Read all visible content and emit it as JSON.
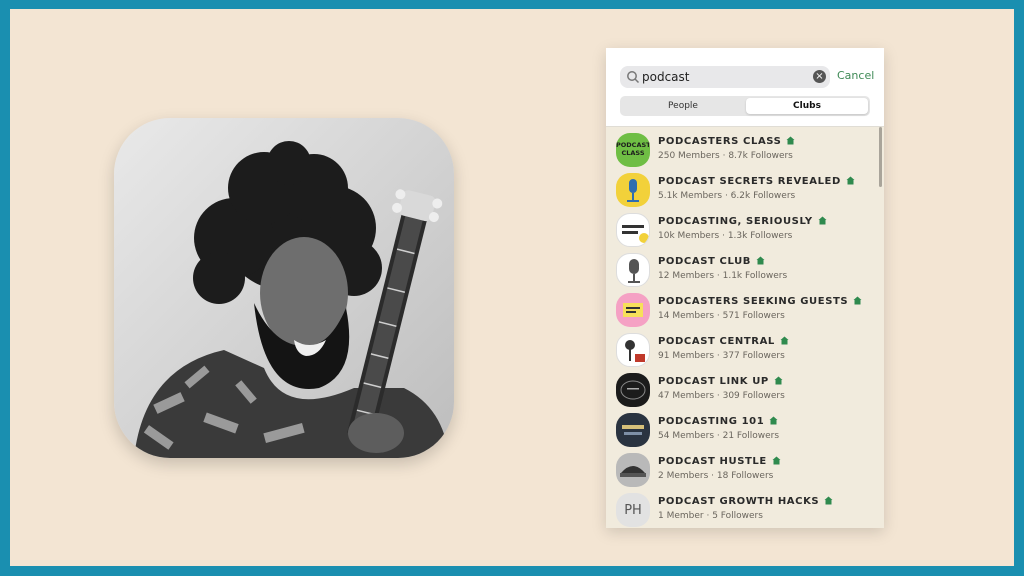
{
  "search": {
    "value": "podcast",
    "cancel_label": "Cancel"
  },
  "tabs": [
    {
      "label": "People",
      "selected": false
    },
    {
      "label": "Clubs",
      "selected": true
    }
  ],
  "clubs": [
    {
      "name": "PODCASTERS CLASS",
      "meta": "250 Members · 8.7k Followers",
      "avatar_text": "PODCAST CLASS",
      "avatar_color": "#6fbe44"
    },
    {
      "name": "PODCAST SECRETS REVEALED",
      "meta": "5.1k Members · 6.2k Followers",
      "avatar_text": "",
      "avatar_color": "#f2d13a"
    },
    {
      "name": "PODCASTING, SERIOUSLY",
      "meta": "10k Members · 1.3k Followers",
      "avatar_text": "",
      "avatar_color": "#ffffff"
    },
    {
      "name": "PODCAST CLUB",
      "meta": "12 Members · 1.1k Followers",
      "avatar_text": "",
      "avatar_color": "#ffffff"
    },
    {
      "name": "PODCASTERS SEEKING GUESTS",
      "meta": "14 Members · 571 Followers",
      "avatar_text": "",
      "avatar_color": "#f5a1c4"
    },
    {
      "name": "PODCAST CENTRAL",
      "meta": "91 Members · 377 Followers",
      "avatar_text": "",
      "avatar_color": "#ffffff"
    },
    {
      "name": "PODCAST LINK UP",
      "meta": "47 Members · 309 Followers",
      "avatar_text": "",
      "avatar_color": "#1b1b1b"
    },
    {
      "name": "PODCASTING 101",
      "meta": "54 Members · 21 Followers",
      "avatar_text": "",
      "avatar_color": "#2a3340"
    },
    {
      "name": "PODCAST HUSTLE",
      "meta": "2 Members · 18 Followers",
      "avatar_text": "",
      "avatar_color": "#b9b9b9"
    },
    {
      "name": "PODCAST GROWTH HACKS",
      "meta": "1 Member · 5 Followers",
      "avatar_text": "PH",
      "avatar_color": "#e2e2e2"
    }
  ],
  "colors": {
    "accent": "#3f8a56",
    "background": "#f3e5d3",
    "border": "#1a8fb0"
  }
}
